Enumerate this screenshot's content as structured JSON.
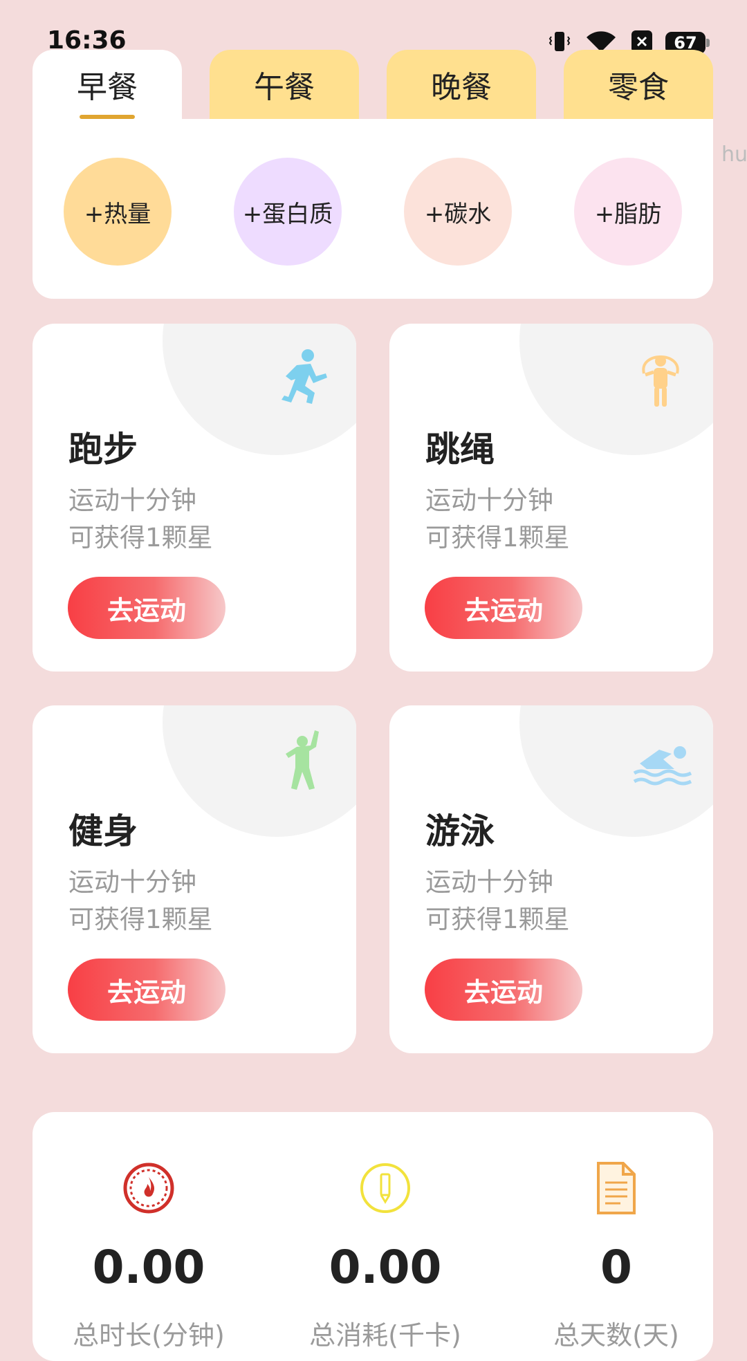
{
  "status_bar": {
    "time": "16:36",
    "battery": "67"
  },
  "meal_tabs": [
    {
      "label": "早餐",
      "active": true
    },
    {
      "label": "午餐",
      "active": false
    },
    {
      "label": "晚餐",
      "active": false
    },
    {
      "label": "零食",
      "active": false
    }
  ],
  "macros": [
    {
      "label": "+热量",
      "color": "#FFDB98"
    },
    {
      "label": "+蛋白质",
      "color": "#EEDCFF"
    },
    {
      "label": "+碳水",
      "color": "#FCE2DA"
    },
    {
      "label": "+脂肪",
      "color": "#FCE3EF"
    }
  ],
  "edge_text": "hu",
  "exercises": [
    {
      "title": "跑步",
      "desc_line1": "运动十分钟",
      "desc_line2": "可获得1颗星",
      "button": "去运动",
      "icon": "running-icon",
      "icon_color": "#7DD0EE"
    },
    {
      "title": "跳绳",
      "desc_line1": "运动十分钟",
      "desc_line2": "可获得1颗星",
      "button": "去运动",
      "icon": "jump-rope-icon",
      "icon_color": "#FFD18A"
    },
    {
      "title": "健身",
      "desc_line1": "运动十分钟",
      "desc_line2": "可获得1颗星",
      "button": "去运动",
      "icon": "fitness-icon",
      "icon_color": "#A6E3A0"
    },
    {
      "title": "游泳",
      "desc_line1": "运动十分钟",
      "desc_line2": "可获得1颗星",
      "button": "去运动",
      "icon": "swimming-icon",
      "icon_color": "#A6D8F5"
    }
  ],
  "stats": [
    {
      "value": "0.00",
      "label": "总时长(分钟)",
      "icon": "flame-gauge-icon",
      "icon_color": "#D0302A"
    },
    {
      "value": "0.00",
      "label": "总消耗(千卡)",
      "icon": "pencil-circle-icon",
      "icon_color": "#F2E23C"
    },
    {
      "value": "0",
      "label": "总天数(天)",
      "icon": "document-icon",
      "icon_color": "#F0A64A"
    }
  ],
  "colors": {
    "background": "#F4DCDC",
    "tab_inactive": "#FFE08F",
    "tab_underline": "#E0A530",
    "button_gradient_start": "#F83F45"
  }
}
